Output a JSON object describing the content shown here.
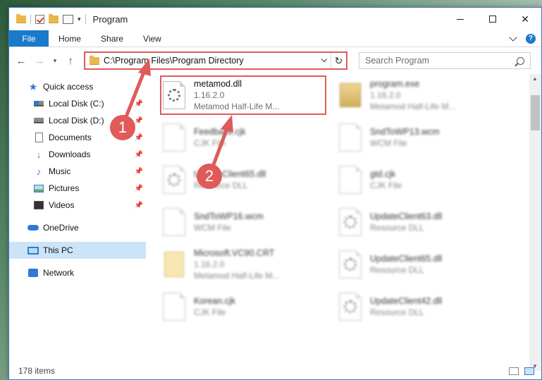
{
  "window": {
    "title": "Program"
  },
  "ribbon": {
    "tabs": [
      "File",
      "Home",
      "Share",
      "View"
    ]
  },
  "navbar": {
    "address": "C:\\Program Files\\Program Directory",
    "search_placeholder": "Search Program"
  },
  "sidebar": {
    "items": [
      {
        "label": "Quick access",
        "icon": "star-icon"
      },
      {
        "label": "Local Disk (C:)",
        "icon": "drive-icon",
        "pinned": true
      },
      {
        "label": "Local Disk (D:)",
        "icon": "drive-icon",
        "pinned": true
      },
      {
        "label": "Documents",
        "icon": "document-icon",
        "pinned": true
      },
      {
        "label": "Downloads",
        "icon": "download-icon",
        "pinned": true
      },
      {
        "label": "Music",
        "icon": "music-icon",
        "pinned": true
      },
      {
        "label": "Pictures",
        "icon": "pictures-icon",
        "pinned": true
      },
      {
        "label": "Videos",
        "icon": "videos-icon",
        "pinned": true
      },
      {
        "label": "OneDrive",
        "icon": "cloud-icon"
      },
      {
        "label": "This PC",
        "icon": "computer-icon",
        "selected": true
      },
      {
        "label": "Network",
        "icon": "network-icon"
      }
    ]
  },
  "files": [
    {
      "name": "metamod.dll",
      "line2": "1.16.2.0",
      "line3": "Metamod Half-Life M...",
      "icon": "dll-gear-icon"
    },
    {
      "name": "program.exe",
      "line2": "1.16.2.0",
      "line3": "Metamod Half-Life M...",
      "icon": "exe-icon"
    },
    {
      "name": "Feedback.cjk",
      "line2": "CJK File",
      "line3": "",
      "icon": "file-icon"
    },
    {
      "name": "SndToWP13.wcm",
      "line2": "WCM File",
      "line3": "",
      "icon": "file-icon"
    },
    {
      "name": "UpdateClient65.dll",
      "line2": "Resource DLL",
      "line3": "",
      "icon": "dll-gear-icon"
    },
    {
      "name": "gtd.cjk",
      "line2": "CJK File",
      "line3": "",
      "icon": "file-icon"
    },
    {
      "name": "SndToWP16.wcm",
      "line2": "WCM File",
      "line3": "",
      "icon": "file-icon"
    },
    {
      "name": "UpdateClient63.dll",
      "line2": "Resource DLL",
      "line3": "",
      "icon": "dll-gear-icon"
    },
    {
      "name": "Microsoft.VC90.CRT",
      "line2": "1.16.2.0",
      "line3": "Metamod Half-Life M...",
      "icon": "crt-icon"
    },
    {
      "name": "UpdateClient65.dll",
      "line2": "Resource DLL",
      "line3": "",
      "icon": "dll-gear-icon"
    },
    {
      "name": "Korean.cjk",
      "line2": "CJK File",
      "line3": "",
      "icon": "file-icon"
    },
    {
      "name": "UpdateClient42.dll",
      "line2": "Resource DLL",
      "line3": "",
      "icon": "dll-gear-icon"
    }
  ],
  "status": {
    "count": "178 items"
  },
  "annotations": {
    "step1": "1",
    "step2": "2",
    "color": "#e05a5a"
  }
}
